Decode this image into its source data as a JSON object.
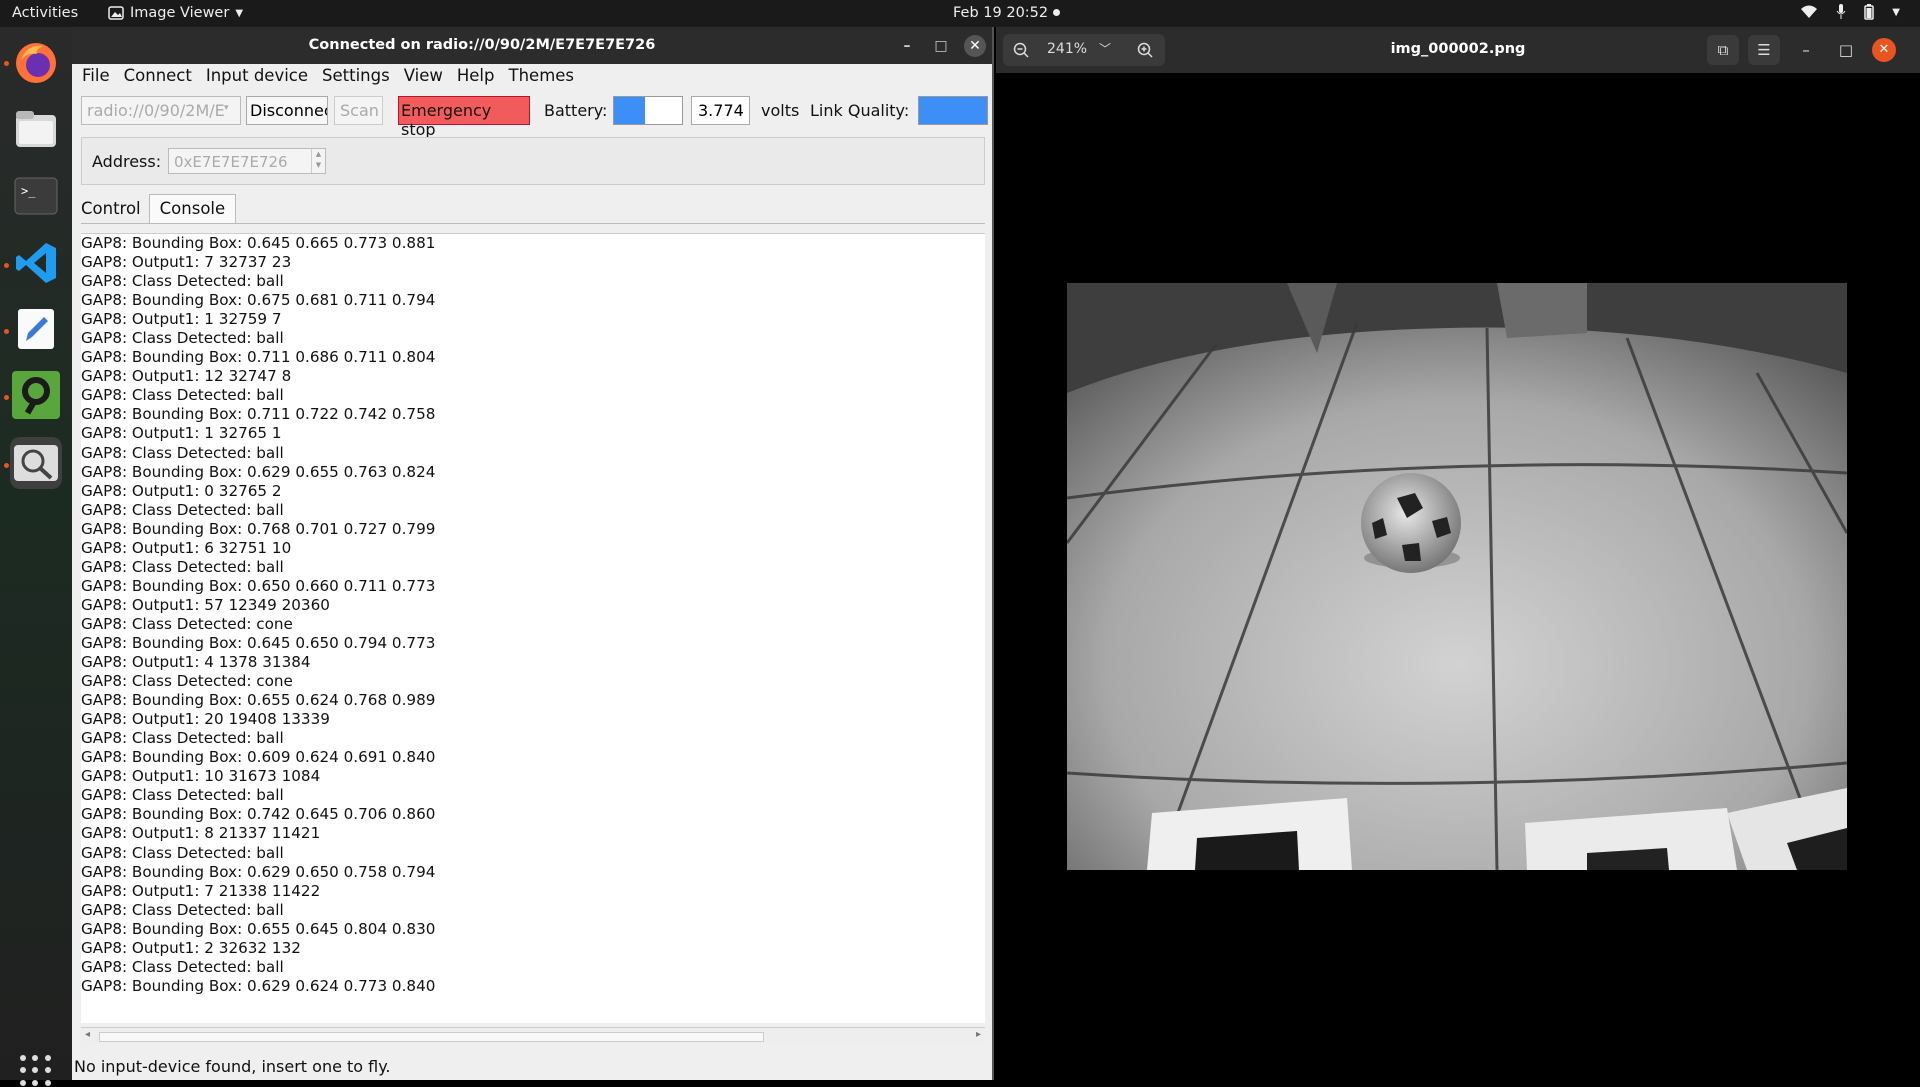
{
  "topbar": {
    "activities": "Activities",
    "app_menu": "Image Viewer",
    "clock": "Feb 19  20:52"
  },
  "client": {
    "title": "Connected on radio://0/90/2M/E7E7E7E726",
    "menu": [
      "File",
      "Connect",
      "Input device",
      "Settings",
      "View",
      "Help",
      "Themes"
    ],
    "toolbar": {
      "uri": "radio://0/90/2M/E",
      "disconnect": "Disconnec",
      "scan": "Scan",
      "estop": "Emergency stop",
      "battery_label": "Battery:",
      "battery_value": "3.774",
      "volts": "volts",
      "link_label": "Link Quality:"
    },
    "battery_level": 0.45,
    "link_quality_level": 1.0,
    "address_label": "Address:",
    "address_value": "0xE7E7E7E726",
    "tabs": [
      "Control",
      "Console"
    ],
    "active_tab": "Console",
    "console_lines": [
      "GAP8: Bounding Box: 0.645 0.665 0.773 0.881",
      "GAP8: Output1: 7 32737 23",
      "GAP8: Class Detected: ball",
      "GAP8: Bounding Box: 0.675 0.681 0.711 0.794",
      "GAP8: Output1: 1 32759 7",
      "GAP8: Class Detected: ball",
      "GAP8: Bounding Box: 0.711 0.686 0.711 0.804",
      "GAP8: Output1: 12 32747 8",
      "GAP8: Class Detected: ball",
      "GAP8: Bounding Box: 0.711 0.722 0.742 0.758",
      "GAP8: Output1: 1 32765 1",
      "GAP8: Class Detected: ball",
      "GAP8: Bounding Box: 0.629 0.655 0.763 0.824",
      "GAP8: Output1: 0 32765 2",
      "GAP8: Class Detected: ball",
      "GAP8: Bounding Box: 0.768 0.701 0.727 0.799",
      "GAP8: Output1: 6 32751 10",
      "GAP8: Class Detected: ball",
      "GAP8: Bounding Box: 0.650 0.660 0.711 0.773",
      "GAP8: Output1: 57 12349 20360",
      "GAP8: Class Detected: cone",
      "GAP8: Bounding Box: 0.645 0.650 0.794 0.773",
      "GAP8: Output1: 4 1378 31384",
      "GAP8: Class Detected: cone",
      "GAP8: Bounding Box: 0.655 0.624 0.768 0.989",
      "GAP8: Output1: 20 19408 13339",
      "GAP8: Class Detected: ball",
      "GAP8: Bounding Box: 0.609 0.624 0.691 0.840",
      "GAP8: Output1: 10 31673 1084",
      "GAP8: Class Detected: ball",
      "GAP8: Bounding Box: 0.742 0.645 0.706 0.860",
      "GAP8: Output1: 8 21337 11421",
      "GAP8: Class Detected: ball",
      "GAP8: Bounding Box: 0.629 0.650 0.758 0.794",
      "GAP8: Output1: 7 21338 11422",
      "GAP8: Class Detected: ball",
      "GAP8: Bounding Box: 0.655 0.645 0.804 0.830",
      "GAP8: Output1: 2 32632 132",
      "GAP8: Class Detected: ball",
      "GAP8: Bounding Box: 0.629 0.624 0.773 0.840"
    ],
    "status": "No input-device found, insert one to fly."
  },
  "viewer": {
    "zoom": "241%",
    "title": "img_000002.png"
  },
  "colors": {
    "estop": "#f25b5b",
    "bar_blue": "#3d8ef7",
    "dock_active": "#e95420"
  }
}
